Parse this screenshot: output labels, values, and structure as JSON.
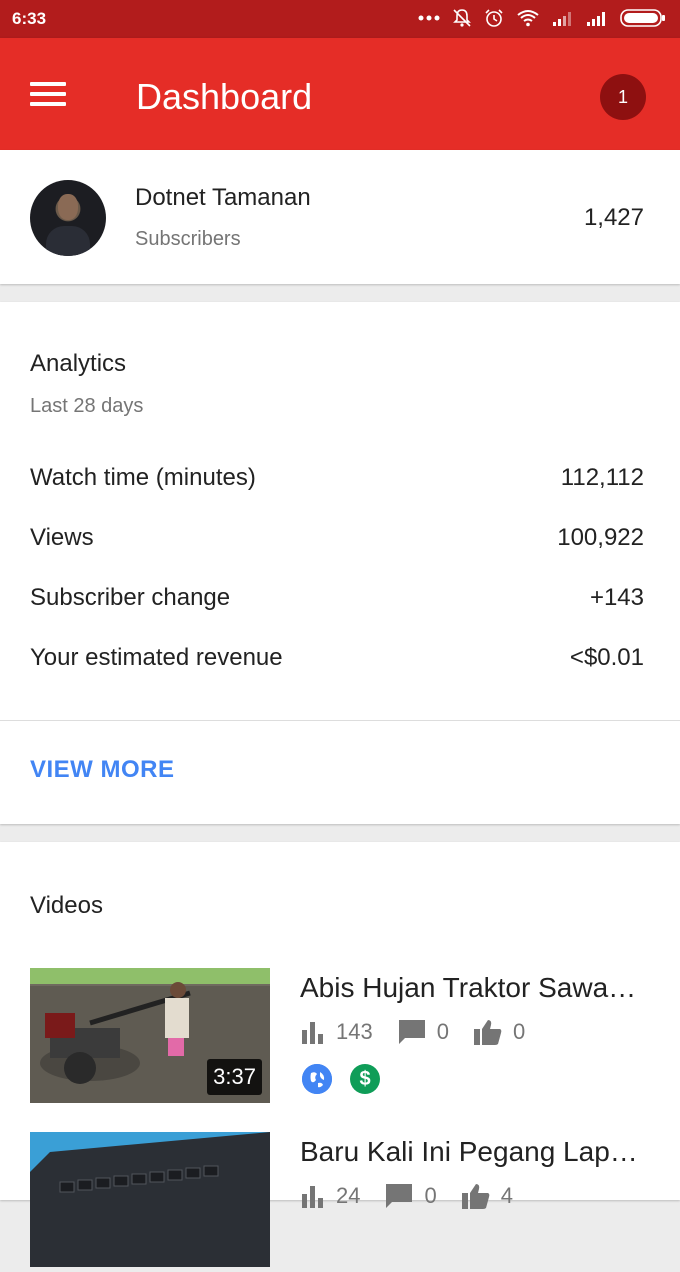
{
  "status_bar": {
    "time": "6:33",
    "icons": [
      "more-dots-icon",
      "bell-muted-icon",
      "alarm-icon",
      "wifi-icon",
      "signal-icon",
      "signal-icon",
      "battery-icon"
    ]
  },
  "app_bar": {
    "title": "Dashboard",
    "menu_icon": "menu-icon",
    "notification_count": "1"
  },
  "channel": {
    "name": "Dotnet Tamanan",
    "subscribers_label": "Subscribers",
    "subscribers_count": "1,427"
  },
  "analytics": {
    "title": "Analytics",
    "period": "Last 28 days",
    "rows": [
      {
        "label": "Watch time (minutes)",
        "value": "112,112"
      },
      {
        "label": "Views",
        "value": "100,922"
      },
      {
        "label": "Subscriber change",
        "value": "+143"
      },
      {
        "label": "Your estimated revenue",
        "value": "<$0.01"
      }
    ],
    "view_more": "VIEW MORE"
  },
  "videos": {
    "title": "Videos",
    "items": [
      {
        "title": "Abis Hujan Traktor Sawah Jalan",
        "duration": "3:37",
        "views": "143",
        "comments": "0",
        "likes": "0",
        "badges": [
          "globe-icon",
          "monetized-icon"
        ]
      },
      {
        "title": "Baru Kali Ini Pegang Laptop ASUS",
        "duration": "",
        "views": "24",
        "comments": "0",
        "likes": "4"
      }
    ]
  },
  "colors": {
    "status_bar": "#b21c1c",
    "app_bar": "#e52d27",
    "badge": "#8e1010",
    "link": "#4285f4",
    "globe_badge": "#4285f4",
    "money_badge": "#0f9d58"
  }
}
